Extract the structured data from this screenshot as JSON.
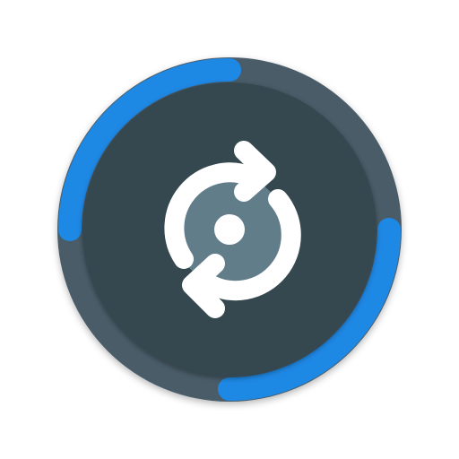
{
  "icon": {
    "name": "sync-icon",
    "colors": {
      "background": "#ffffff",
      "outer_ring": "#4a5c68",
      "inner_disc": "#36464f",
      "progress_arc": "#1e88e5",
      "center_disc": "#617d8a",
      "glyph": "#ffffff",
      "shadow": "#000000"
    }
  }
}
